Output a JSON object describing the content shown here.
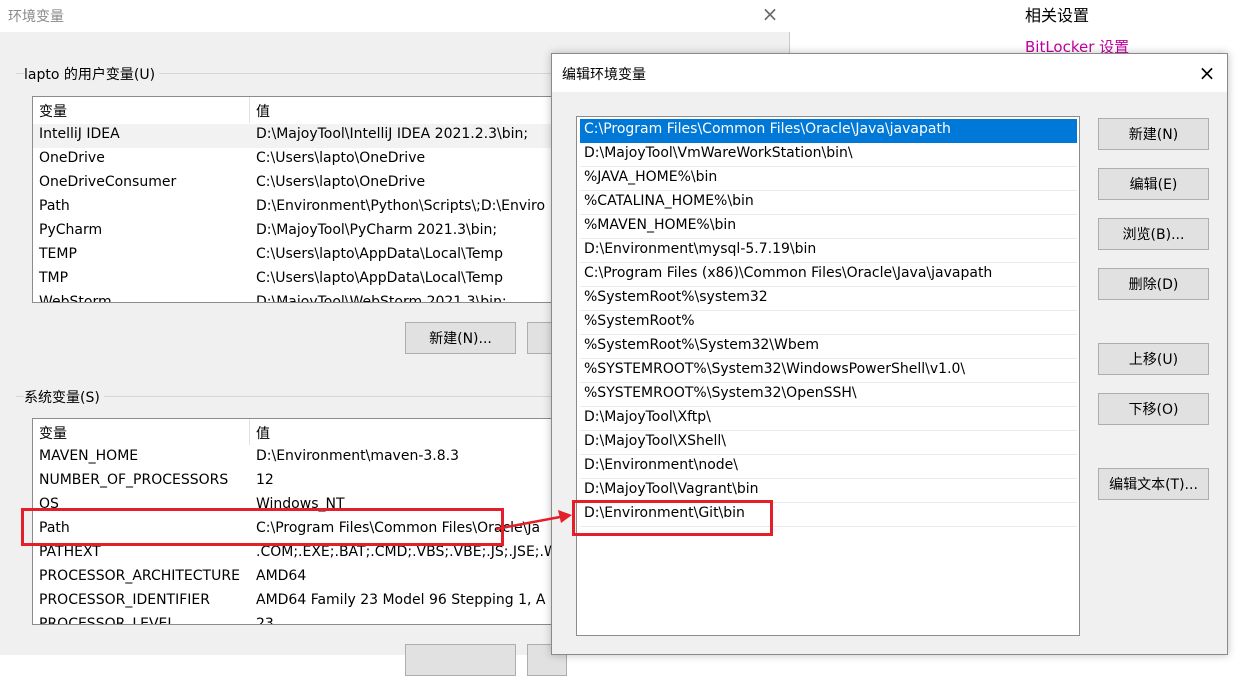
{
  "settings": {
    "related_title": "相关设置",
    "bitlocker_link": "BitLocker 设置",
    "link_color": "#c2009e"
  },
  "env_window": {
    "title": "环境变量",
    "close_icon": "×",
    "user_group_label": "lapto 的用户变量(U)",
    "system_group_label": "系统变量(S)",
    "col_name": "变量",
    "col_value": "值",
    "user_vars": [
      {
        "name": "IntelliJ IDEA",
        "value": "D:\\MajoyTool\\IntelliJ IDEA 2021.2.3\\bin;"
      },
      {
        "name": "OneDrive",
        "value": "C:\\Users\\lapto\\OneDrive"
      },
      {
        "name": "OneDriveConsumer",
        "value": "C:\\Users\\lapto\\OneDrive"
      },
      {
        "name": "Path",
        "value": "D:\\Environment\\Python\\Scripts\\;D:\\Enviro"
      },
      {
        "name": "PyCharm",
        "value": "D:\\MajoyTool\\PyCharm 2021.3\\bin;"
      },
      {
        "name": "TEMP",
        "value": "C:\\Users\\lapto\\AppData\\Local\\Temp"
      },
      {
        "name": "TMP",
        "value": "C:\\Users\\lapto\\AppData\\Local\\Temp"
      },
      {
        "name": "WebStorm",
        "value": "D:\\MajoyTool\\WebStorm 2021.3\\bin;"
      }
    ],
    "user_new_button": "新建(N)...",
    "system_vars": [
      {
        "name": "MAVEN_HOME",
        "value": "D:\\Environment\\maven-3.8.3"
      },
      {
        "name": "NUMBER_OF_PROCESSORS",
        "value": "12"
      },
      {
        "name": "OS",
        "value": "Windows_NT"
      },
      {
        "name": "Path",
        "value": "C:\\Program Files\\Common Files\\Oracle\\Ja"
      },
      {
        "name": "PATHEXT",
        "value": ".COM;.EXE;.BAT;.CMD;.VBS;.VBE;.JS;.JSE;.W"
      },
      {
        "name": "PROCESSOR_ARCHITECTURE",
        "value": "AMD64"
      },
      {
        "name": "PROCESSOR_IDENTIFIER",
        "value": "AMD64 Family 23 Model 96 Stepping 1, A"
      },
      {
        "name": "PROCESSOR_LEVEL",
        "value": "23"
      }
    ]
  },
  "edit_dialog": {
    "title": "编辑环境变量",
    "close_icon": "×",
    "paths": [
      "C:\\Program Files\\Common Files\\Oracle\\Java\\javapath",
      "D:\\MajoyTool\\VmWareWorkStation\\bin\\",
      "%JAVA_HOME%\\bin",
      "%CATALINA_HOME%\\bin",
      "%MAVEN_HOME%\\bin",
      "D:\\Environment\\mysql-5.7.19\\bin",
      "C:\\Program Files (x86)\\Common Files\\Oracle\\Java\\javapath",
      "%SystemRoot%\\system32",
      "%SystemRoot%",
      "%SystemRoot%\\System32\\Wbem",
      "%SYSTEMROOT%\\System32\\WindowsPowerShell\\v1.0\\",
      "%SYSTEMROOT%\\System32\\OpenSSH\\",
      "D:\\MajoyTool\\Xftp\\",
      "D:\\MajoyTool\\XShell\\",
      "D:\\Environment\\node\\",
      "D:\\MajoyTool\\Vagrant\\bin",
      "D:\\Environment\\Git\\bin"
    ],
    "buttons": {
      "new": "新建(N)",
      "edit": "编辑(E)",
      "browse": "浏览(B)...",
      "delete": "删除(D)",
      "move_up": "上移(U)",
      "move_down": "下移(O)",
      "edit_text": "编辑文本(T)..."
    },
    "selection_color": "#0078d7"
  },
  "annotation": {
    "color": "#e3202a"
  }
}
